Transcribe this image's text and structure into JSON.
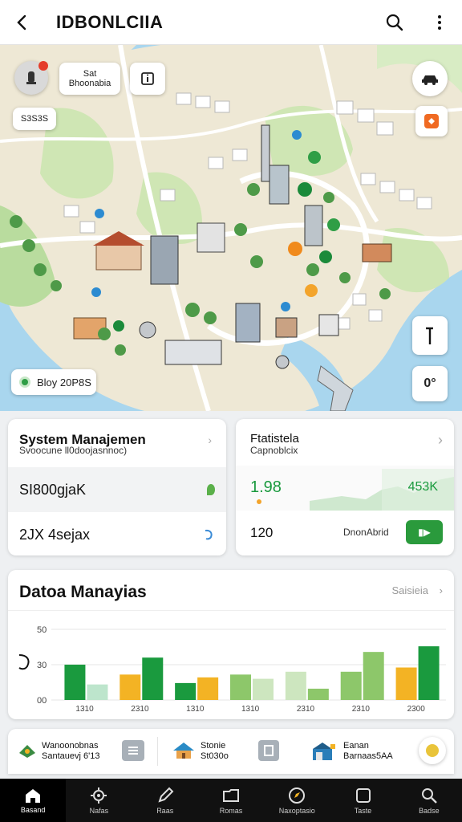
{
  "header": {
    "title": "IDBONLCIIA"
  },
  "map": {
    "chip_top": "Sat\nBhoonabia",
    "chip_left": "S3S3S",
    "chip_day": "Bloy 20P8S",
    "btn_right_bottom": "0°"
  },
  "system_card": {
    "title": "System Manajemen",
    "subtitle": "Svoocune ll0doojasnnoc)",
    "row1": "SI800gjaK",
    "row2": "2JX 4sejax"
  },
  "stats_card": {
    "title": "Ftatistela",
    "subtitle": "Capnoblcix",
    "value_left": "1.98",
    "value_right": "453K",
    "bottom_left": "120",
    "bottom_mid": "DnonAbrid"
  },
  "chart_card": {
    "title": "Datoa Manayias",
    "link": "Saisieia"
  },
  "chart_data": {
    "type": "bar",
    "yticks": [
      "50",
      "30",
      "00"
    ],
    "xticks": [
      "1310",
      "2310",
      "1310",
      "1310",
      "2310",
      "2310",
      "2300"
    ],
    "series": [
      {
        "values": [
          2.5,
          1.8,
          1.2,
          1.8,
          2.0,
          2.0,
          2.3
        ]
      },
      {
        "values": [
          1.1,
          3.0,
          1.6,
          1.5,
          0.8,
          3.4,
          3.8
        ]
      }
    ],
    "colors": [
      "#1a9a3e",
      "#f3b324",
      "#8dc76a",
      "#cde6bf",
      "#bde5cc"
    ],
    "ylim": [
      0,
      5
    ]
  },
  "mini_cards": [
    {
      "line1": "Wanoonobnas",
      "line2": "Santauevj 6'13"
    },
    {
      "line1": "Stonie",
      "line2": "St030o"
    },
    {
      "line1": "Eanan",
      "line2": "Barnaas5AA"
    }
  ],
  "nav": {
    "items": [
      {
        "label": "Basand",
        "icon": "home-icon"
      },
      {
        "label": "Nafas",
        "icon": "cog-icon"
      },
      {
        "label": "Raas",
        "icon": "pen-icon"
      },
      {
        "label": "Romas",
        "icon": "folder-icon"
      },
      {
        "label": "Naxoptasio",
        "icon": "compass-icon"
      },
      {
        "label": "Taste",
        "icon": "tablet-icon"
      },
      {
        "label": "Badse",
        "icon": "search-icon"
      }
    ]
  }
}
